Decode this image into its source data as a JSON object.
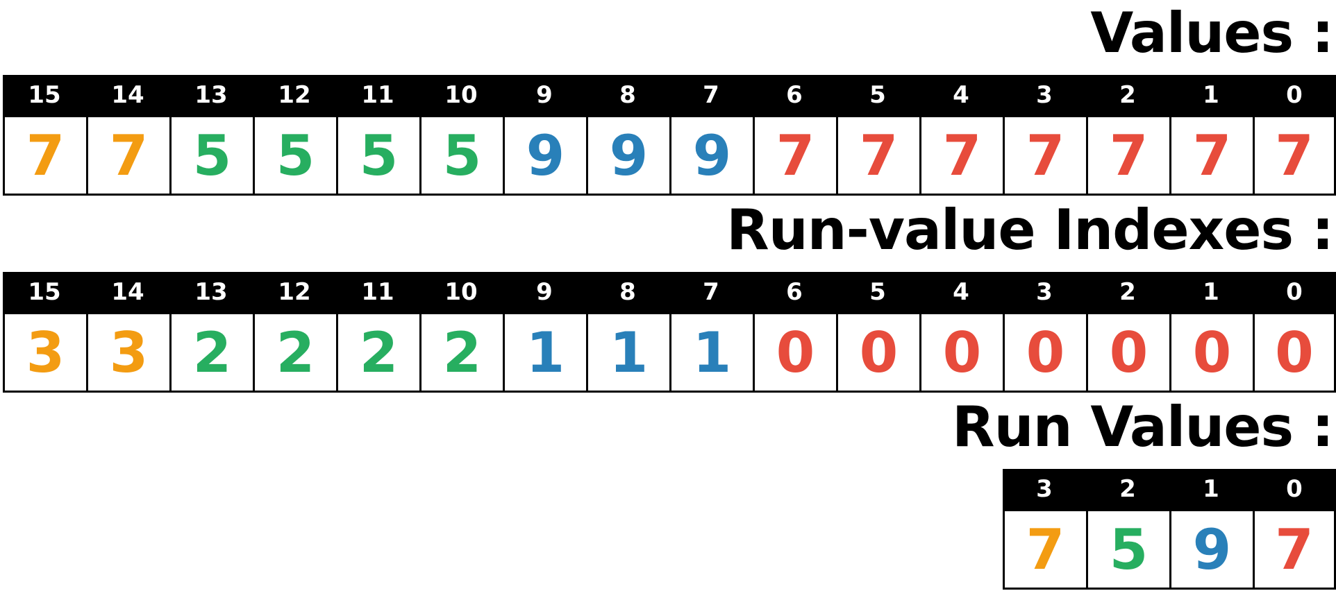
{
  "colors": {
    "orange": "#f39c12",
    "green": "#27ae60",
    "blue": "#2980b9",
    "red": "#e74c3c"
  },
  "values_section": {
    "title": "Values :",
    "indices": [
      "15",
      "14",
      "13",
      "12",
      "11",
      "10",
      "9",
      "8",
      "7",
      "6",
      "5",
      "4",
      "3",
      "2",
      "1",
      "0"
    ],
    "values": [
      "7",
      "7",
      "5",
      "5",
      "5",
      "5",
      "9",
      "9",
      "9",
      "7",
      "7",
      "7",
      "7",
      "7",
      "7",
      "7"
    ],
    "value_colors": [
      "orange",
      "orange",
      "green",
      "green",
      "green",
      "green",
      "blue",
      "blue",
      "blue",
      "red",
      "red",
      "red",
      "red",
      "red",
      "red",
      "red"
    ]
  },
  "indexes_section": {
    "title": "Run-value Indexes :",
    "indices": [
      "15",
      "14",
      "13",
      "12",
      "11",
      "10",
      "9",
      "8",
      "7",
      "6",
      "5",
      "4",
      "3",
      "2",
      "1",
      "0"
    ],
    "values": [
      "3",
      "3",
      "2",
      "2",
      "2",
      "2",
      "1",
      "1",
      "1",
      "0",
      "0",
      "0",
      "0",
      "0",
      "0",
      "0"
    ],
    "value_colors": [
      "orange",
      "orange",
      "green",
      "green",
      "green",
      "green",
      "blue",
      "blue",
      "blue",
      "red",
      "red",
      "red",
      "red",
      "red",
      "red",
      "red"
    ]
  },
  "runvalues_section": {
    "title": "Run Values :",
    "indices": [
      "3",
      "2",
      "1",
      "0"
    ],
    "values": [
      "7",
      "5",
      "9",
      "7"
    ],
    "value_colors": [
      "orange",
      "green",
      "blue",
      "red"
    ]
  }
}
